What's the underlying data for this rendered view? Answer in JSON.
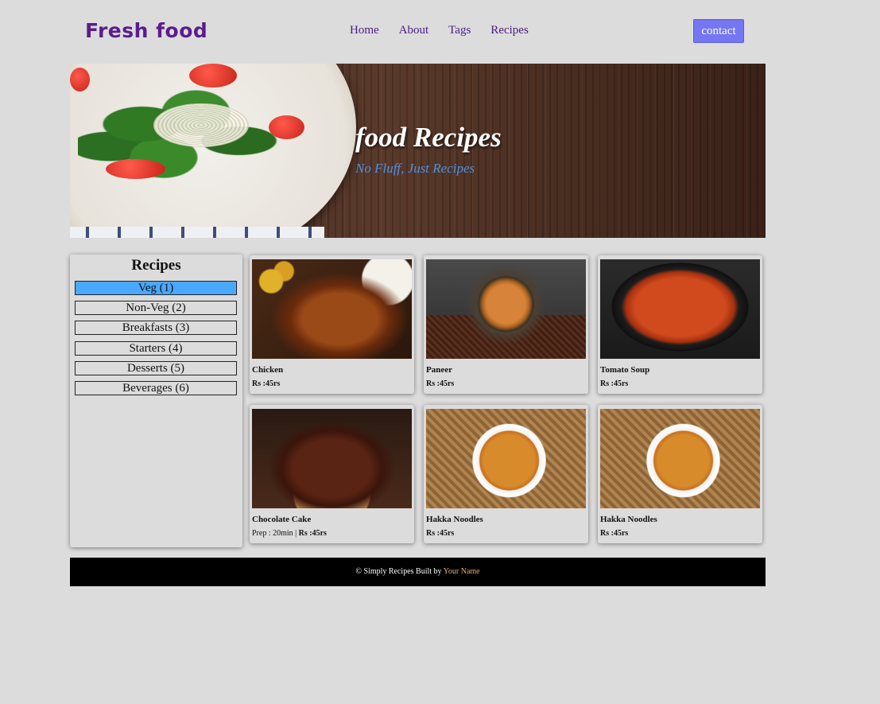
{
  "header": {
    "logo": "Fresh food",
    "nav": [
      "Home",
      "About",
      "Tags",
      "Recipes"
    ],
    "contact_label": "contact"
  },
  "hero": {
    "title": "food Recipes",
    "subtitle": "No Fluff, Just Recipes"
  },
  "sidebar": {
    "title": "Recipes",
    "categories": [
      {
        "label": "Veg (1)",
        "active": true
      },
      {
        "label": "Non-Veg (2)",
        "active": false
      },
      {
        "label": "Breakfasts (3)",
        "active": false
      },
      {
        "label": "Starters (4)",
        "active": false
      },
      {
        "label": "Desserts (5)",
        "active": false
      },
      {
        "label": "Beverages (6)",
        "active": false
      }
    ]
  },
  "recipes": [
    {
      "name": "Chicken",
      "price": "Rs :45rs",
      "image": "chicken-curry"
    },
    {
      "name": "Paneer",
      "price": "Rs :45rs",
      "image": "paneer-curry"
    },
    {
      "name": "Tomato Soup",
      "price": "Rs :45rs",
      "image": "tomato-soup"
    },
    {
      "name": "Chocolate Cake",
      "prep": "Prep : 20min |",
      "price": "Rs :45rs",
      "image": "chocolate-cake"
    },
    {
      "name": "Hakka Noodles",
      "price": "Rs :45rs",
      "image": "hakka-noodles"
    },
    {
      "name": "Hakka Noodles",
      "price": "Rs :45rs",
      "image": "hakka-noodles"
    }
  ],
  "footer": {
    "text": "© Simply Recipes Built by",
    "author": "Your Name"
  },
  "colors": {
    "background": "#dcdcdc",
    "logo": "#5b1c8c",
    "nav": "#4b1a86",
    "contact_button": "#7476f2",
    "active_category": "#4aa8ff",
    "hero_subtitle": "#4f8fe2",
    "footer_bg": "#000000",
    "footer_author": "#e0b07a"
  }
}
